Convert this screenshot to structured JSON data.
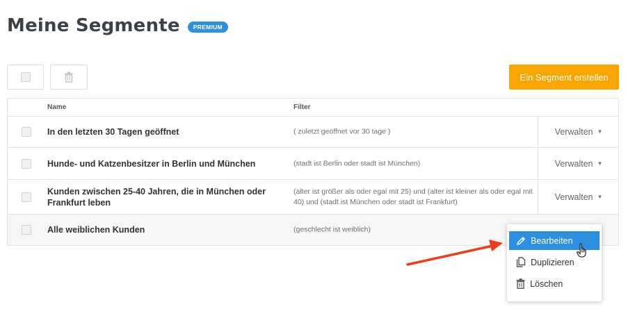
{
  "header": {
    "title": "Meine Segmente",
    "badge": "PREMIUM"
  },
  "toolbar": {
    "create_label": "Ein Segment erstellen"
  },
  "table": {
    "columns": {
      "name": "Name",
      "filter": "Filter"
    },
    "rows": [
      {
        "name": "In den letzten 30 Tagen geöffnet",
        "filter": "( zuletzt geöffnet vor 30 tage )",
        "action": "Verwalten"
      },
      {
        "name": "Hunde- und Katzenbesitzer in Berlin und München",
        "filter": "(stadt ist Berlin oder stadt ist München)",
        "action": "Verwalten"
      },
      {
        "name": "Kunden zwischen 25-40 Jahren, die in München oder Frankfurt leben",
        "filter": "(alter ist größer als oder egal mit 25) und (alter ist kleiner als oder egal mit 40) und (stadt ist München oder stadt ist Frankfurt)",
        "action": "Verwalten"
      },
      {
        "name": "Alle weiblichen Kunden",
        "filter": "(geschlecht ist weiblich)"
      }
    ]
  },
  "menu": {
    "items": [
      {
        "label": "Bearbeiten",
        "icon": "pencil-icon",
        "active": true
      },
      {
        "label": "Duplizieren",
        "icon": "copy-icon",
        "active": false
      },
      {
        "label": "Löschen",
        "icon": "trash-icon",
        "active": false
      }
    ]
  },
  "colors": {
    "accent": "#2d8fe0",
    "create_button": "#f9a600",
    "annotation_arrow": "#f03c1e"
  }
}
